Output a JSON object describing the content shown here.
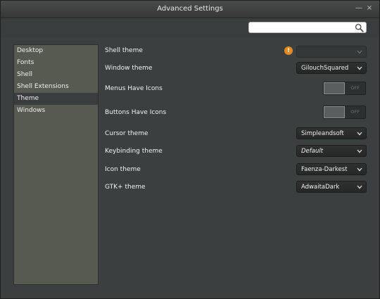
{
  "window": {
    "title": "Advanced Settings",
    "minimize_glyph": "—",
    "close_glyph": "×"
  },
  "search": {
    "value": "",
    "placeholder": "",
    "icon": "search-icon"
  },
  "sidebar": {
    "items": [
      {
        "label": "Desktop",
        "selected": false
      },
      {
        "label": "Fonts",
        "selected": false
      },
      {
        "label": "Shell",
        "selected": false
      },
      {
        "label": "Shell Extensions",
        "selected": false
      },
      {
        "label": "Theme",
        "selected": true
      },
      {
        "label": "Windows",
        "selected": false
      }
    ]
  },
  "settings": {
    "shell_theme": {
      "label": "Shell theme",
      "value": "",
      "warning": "!"
    },
    "window_theme": {
      "label": "Window theme",
      "value": "GilouchSquared"
    },
    "menus_have_icons": {
      "label": "Menus Have Icons",
      "state": "OFF"
    },
    "buttons_have_icons": {
      "label": "Buttons Have Icons",
      "state": "OFF"
    },
    "cursor_theme": {
      "label": "Cursor theme",
      "value": "Simpleandsoft"
    },
    "keybinding_theme": {
      "label": "Keybinding theme",
      "value": "Default"
    },
    "icon_theme": {
      "label": "Icon theme",
      "value": "Faenza-Darkest"
    },
    "gtk_theme": {
      "label": "GTK+ theme",
      "value": "AdwaitaDark"
    }
  },
  "colors": {
    "window_bg": "#3b3f40",
    "sidebar_bg": "#565a51",
    "warning": "#e58a1f"
  }
}
